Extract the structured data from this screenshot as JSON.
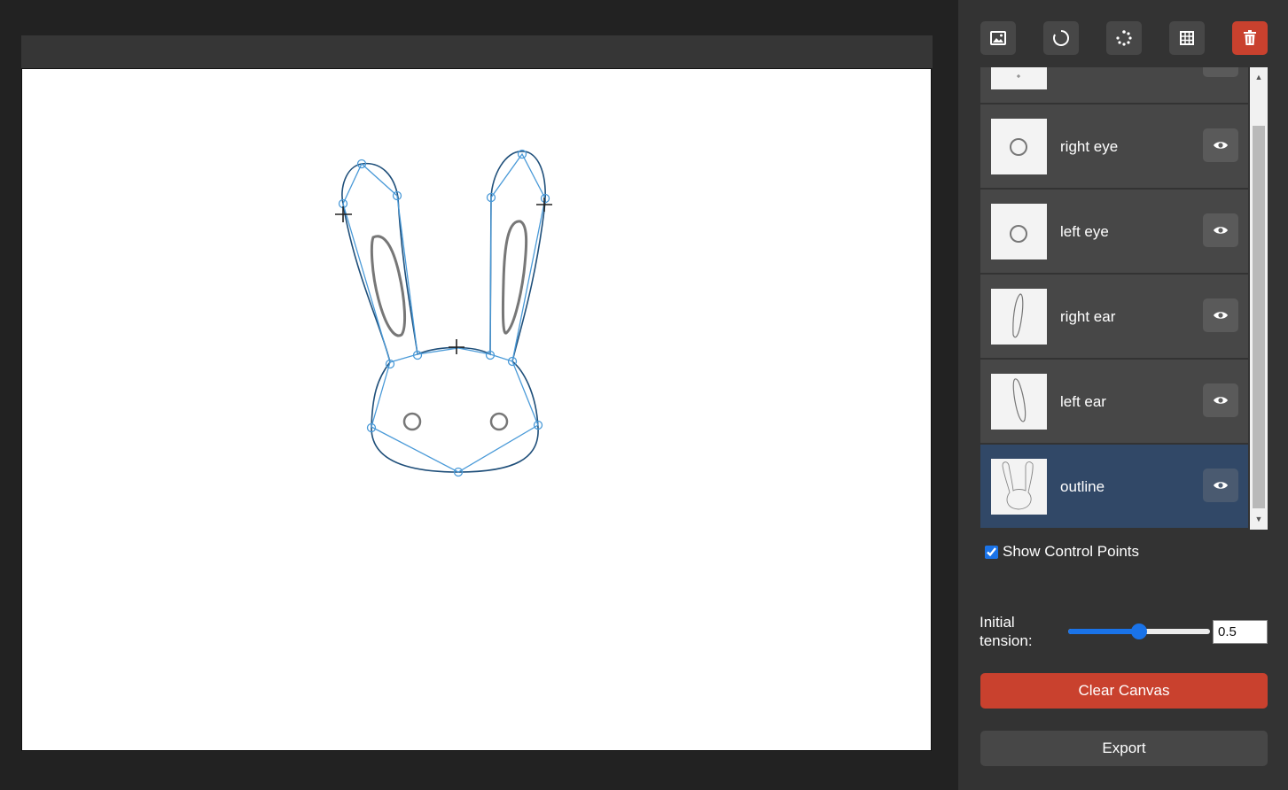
{
  "toolbar": {
    "buttons": [
      {
        "icon": "image-icon"
      },
      {
        "icon": "circle-arrow-icon"
      },
      {
        "icon": "dots-circle-icon"
      },
      {
        "icon": "grid-icon"
      },
      {
        "icon": "trash-icon",
        "color": "#c9412e"
      }
    ]
  },
  "layers": [
    {
      "name": "right eye"
    },
    {
      "name": "left eye"
    },
    {
      "name": "right ear"
    },
    {
      "name": "left ear"
    },
    {
      "name": "outline",
      "selected": true
    }
  ],
  "options": {
    "show_control_points_label": "Show Control Points",
    "show_control_points": true,
    "tension_label": "Initial tension:",
    "tension_value": "0.5",
    "tension_fraction": 0.5
  },
  "actions": {
    "clear_label": "Clear Canvas",
    "export_label": "Export"
  },
  "colors": {
    "accent": "#1a73e8",
    "danger": "#c9412e",
    "selected_layer": "#314867",
    "control_point": "#4a9ad8"
  }
}
